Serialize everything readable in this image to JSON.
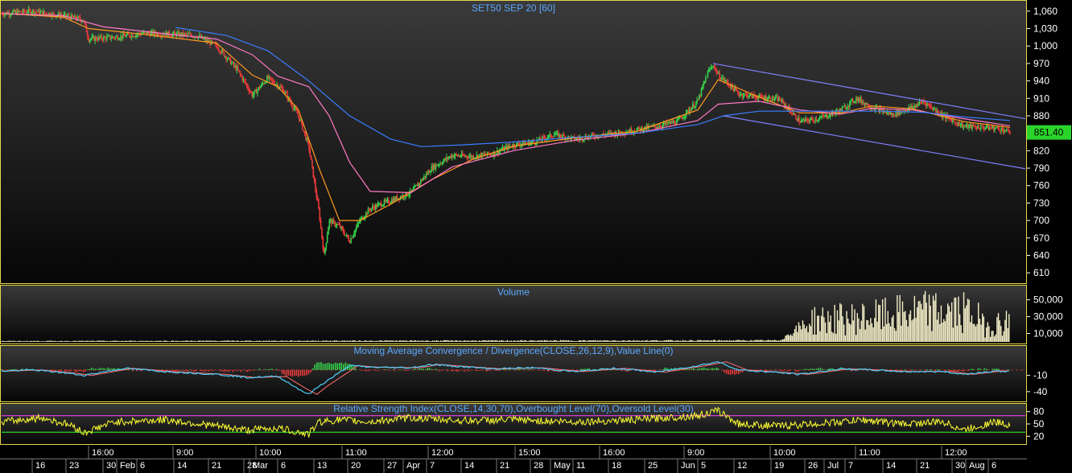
{
  "colors": {
    "background_top": "#3a3a3a",
    "background_bottom": "#050505",
    "panel_border": "#e8d84a",
    "title_text": "#5aa8ff",
    "axis_text": "#ffffff",
    "bull_candle": "#34d34a",
    "bear_candle": "#e83a3a",
    "ma_fast": "#ff9a20",
    "ma_mid": "#ff79c6",
    "ma_slow": "#3a7dff",
    "channel": "#8080ff",
    "volume": "#f4efc8",
    "macd_line": "#4fd0ff",
    "signal_line": "#ff7070",
    "rsi_line": "#ffff33",
    "rsi_overbought": "#ff44ff",
    "rsi_oversold": "#33ff33",
    "last_price_bg": "#2bd42b"
  },
  "chart_data": [
    {
      "type": "candlestick",
      "title": "SET50 SEP 20   [60]",
      "last_price_label": "851.40",
      "y_ticks": [
        "1,060",
        "1,030",
        "1,000",
        "970",
        "940",
        "910",
        "880",
        "850",
        "820",
        "790",
        "760",
        "730",
        "700",
        "670",
        "640",
        "610"
      ],
      "ylim": [
        595,
        1075
      ],
      "x_range": [
        0,
        1000
      ],
      "close_path": [
        [
          0,
          1056
        ],
        [
          30,
          1060
        ],
        [
          60,
          1052
        ],
        [
          80,
          1045
        ],
        [
          85,
          1012
        ],
        [
          110,
          1015
        ],
        [
          140,
          1022
        ],
        [
          170,
          1020
        ],
        [
          190,
          1018
        ],
        [
          210,
          1000
        ],
        [
          230,
          960
        ],
        [
          245,
          915
        ],
        [
          260,
          945
        ],
        [
          275,
          925
        ],
        [
          290,
          880
        ],
        [
          300,
          828
        ],
        [
          310,
          715
        ],
        [
          315,
          640
        ],
        [
          320,
          700
        ],
        [
          330,
          690
        ],
        [
          340,
          665
        ],
        [
          350,
          700
        ],
        [
          360,
          720
        ],
        [
          370,
          728
        ],
        [
          380,
          734
        ],
        [
          400,
          748
        ],
        [
          420,
          790
        ],
        [
          440,
          812
        ],
        [
          460,
          810
        ],
        [
          480,
          815
        ],
        [
          500,
          830
        ],
        [
          520,
          835
        ],
        [
          540,
          848
        ],
        [
          560,
          840
        ],
        [
          580,
          846
        ],
        [
          600,
          850
        ],
        [
          620,
          856
        ],
        [
          640,
          862
        ],
        [
          660,
          870
        ],
        [
          680,
          905
        ],
        [
          690,
          955
        ],
        [
          695,
          968
        ],
        [
          700,
          950
        ],
        [
          710,
          935
        ],
        [
          720,
          918
        ],
        [
          740,
          912
        ],
        [
          760,
          908
        ],
        [
          780,
          870
        ],
        [
          800,
          876
        ],
        [
          820,
          890
        ],
        [
          835,
          910
        ],
        [
          850,
          895
        ],
        [
          870,
          882
        ],
        [
          890,
          895
        ],
        [
          900,
          905
        ],
        [
          920,
          880
        ],
        [
          940,
          862
        ],
        [
          960,
          860
        ],
        [
          975,
          858
        ],
        [
          985,
          851.4
        ]
      ],
      "overlays": [
        {
          "name": "MA fast",
          "values": [
            [
              0,
              1056
            ],
            [
              60,
              1050
            ],
            [
              85,
              1030
            ],
            [
              140,
              1020
            ],
            [
              210,
              1005
            ],
            [
              245,
              950
            ],
            [
              270,
              930
            ],
            [
              290,
              890
            ],
            [
              310,
              790
            ],
            [
              330,
              700
            ],
            [
              350,
              700
            ],
            [
              380,
              728
            ],
            [
              420,
              770
            ],
            [
              460,
              805
            ],
            [
              500,
              828
            ],
            [
              560,
              842
            ],
            [
              620,
              853
            ],
            [
              680,
              890
            ],
            [
              700,
              942
            ],
            [
              740,
              912
            ],
            [
              780,
              885
            ],
            [
              820,
              885
            ],
            [
              850,
              897
            ],
            [
              890,
              892
            ],
            [
              940,
              870
            ],
            [
              985,
              860
            ]
          ]
        },
        {
          "name": "MA mid",
          "values": [
            [
              0,
              1056
            ],
            [
              60,
              1052
            ],
            [
              100,
              1033
            ],
            [
              160,
              1021
            ],
            [
              210,
              1012
            ],
            [
              245,
              985
            ],
            [
              270,
              948
            ],
            [
              300,
              930
            ],
            [
              320,
              880
            ],
            [
              340,
              800
            ],
            [
              360,
              750
            ],
            [
              400,
              748
            ],
            [
              440,
              792
            ],
            [
              500,
              820
            ],
            [
              560,
              838
            ],
            [
              620,
              850
            ],
            [
              680,
              872
            ],
            [
              700,
              900
            ],
            [
              740,
              905
            ],
            [
              780,
              890
            ],
            [
              820,
              883
            ],
            [
              850,
              893
            ],
            [
              890,
              890
            ],
            [
              940,
              875
            ],
            [
              985,
              863
            ]
          ]
        },
        {
          "name": "MA slow",
          "values": [
            [
              170,
              1032
            ],
            [
              220,
              1018
            ],
            [
              260,
              992
            ],
            [
              300,
              940
            ],
            [
              340,
              880
            ],
            [
              380,
              840
            ],
            [
              410,
              827
            ],
            [
              450,
              830
            ],
            [
              500,
              835
            ],
            [
              560,
              843
            ],
            [
              620,
              850
            ],
            [
              680,
              865
            ],
            [
              705,
              880
            ],
            [
              740,
              888
            ],
            [
              780,
              888
            ],
            [
              820,
              888
            ],
            [
              860,
              888
            ],
            [
              900,
              886
            ],
            [
              940,
              878
            ],
            [
              985,
              872
            ]
          ]
        },
        {
          "name": "Channel top",
          "values": [
            [
              695,
              970
            ],
            [
              1000,
              875
            ]
          ]
        },
        {
          "name": "Channel bottom",
          "values": [
            [
              705,
              880
            ],
            [
              1000,
              789
            ]
          ]
        }
      ]
    },
    {
      "type": "bar",
      "title": "Volume",
      "y_ticks": [
        "50,000",
        "30,000",
        "10,000"
      ],
      "ylim": [
        0,
        65000
      ],
      "profile": [
        [
          0,
          1000
        ],
        [
          760,
          1800
        ],
        [
          780,
          18000
        ],
        [
          790,
          28000
        ],
        [
          850,
          32000
        ],
        [
          900,
          40000
        ],
        [
          950,
          38000
        ],
        [
          960,
          20000
        ],
        [
          985,
          28000
        ]
      ]
    },
    {
      "type": "line",
      "title": "Moving Average Convergence / Divergence(CLOSE,26,12,9),Value Line(0)",
      "y_ticks": [
        "-10",
        "-40"
      ],
      "ylim": [
        -55,
        25
      ],
      "profile": [
        [
          0,
          -2
        ],
        [
          30,
          0
        ],
        [
          60,
          -5
        ],
        [
          80,
          -10
        ],
        [
          120,
          3
        ],
        [
          160,
          -3
        ],
        [
          210,
          -8
        ],
        [
          240,
          -14
        ],
        [
          270,
          -12
        ],
        [
          290,
          -35
        ],
        [
          300,
          -45
        ],
        [
          310,
          -30
        ],
        [
          330,
          -5
        ],
        [
          340,
          8
        ],
        [
          360,
          5
        ],
        [
          400,
          4
        ],
        [
          420,
          10
        ],
        [
          450,
          6
        ],
        [
          480,
          2
        ],
        [
          520,
          4
        ],
        [
          560,
          -3
        ],
        [
          600,
          3
        ],
        [
          640,
          -4
        ],
        [
          680,
          8
        ],
        [
          700,
          15
        ],
        [
          720,
          0
        ],
        [
          760,
          -5
        ],
        [
          780,
          -8
        ],
        [
          820,
          2
        ],
        [
          850,
          0
        ],
        [
          880,
          -3
        ],
        [
          920,
          -3
        ],
        [
          940,
          -8
        ],
        [
          970,
          -2
        ],
        [
          985,
          -3
        ]
      ]
    },
    {
      "type": "line",
      "title": "Relative Strength Index(CLOSE,14,30,70),Overbought Level(70),Oversold Level(30)",
      "y_ticks": [
        "80",
        "50",
        "20"
      ],
      "ylim": [
        5,
        95
      ],
      "overbought": 70,
      "oversold": 30,
      "profile": [
        [
          0,
          55
        ],
        [
          40,
          65
        ],
        [
          70,
          45
        ],
        [
          80,
          28
        ],
        [
          110,
          55
        ],
        [
          160,
          60
        ],
        [
          210,
          45
        ],
        [
          240,
          35
        ],
        [
          270,
          40
        ],
        [
          290,
          30
        ],
        [
          300,
          25
        ],
        [
          310,
          55
        ],
        [
          330,
          60
        ],
        [
          360,
          55
        ],
        [
          400,
          65
        ],
        [
          420,
          62
        ],
        [
          450,
          58
        ],
        [
          500,
          60
        ],
        [
          560,
          55
        ],
        [
          620,
          60
        ],
        [
          680,
          70
        ],
        [
          700,
          82
        ],
        [
          720,
          50
        ],
        [
          760,
          45
        ],
        [
          780,
          48
        ],
        [
          820,
          55
        ],
        [
          840,
          60
        ],
        [
          880,
          50
        ],
        [
          920,
          55
        ],
        [
          940,
          35
        ],
        [
          970,
          55
        ],
        [
          985,
          48
        ]
      ]
    }
  ],
  "x_axis": {
    "time_labels": [
      "16:00",
      "9:00",
      "10:00",
      "11:00",
      "12:00",
      "15:00",
      "16:00",
      "9:00",
      "10:00",
      "11:00",
      "12:00"
    ],
    "date_labels": [
      "16",
      "23",
      "30",
      "Feb",
      "6",
      "14",
      "21",
      "28",
      "Mar",
      "6",
      "13",
      "20",
      "27",
      "Apr",
      "7",
      "14",
      "21",
      "28",
      "May",
      "11",
      "18",
      "25",
      "Jun",
      "5",
      "12",
      "19",
      "26",
      "Jul",
      "7",
      "14",
      "21",
      "30",
      "Aug",
      "6"
    ]
  }
}
